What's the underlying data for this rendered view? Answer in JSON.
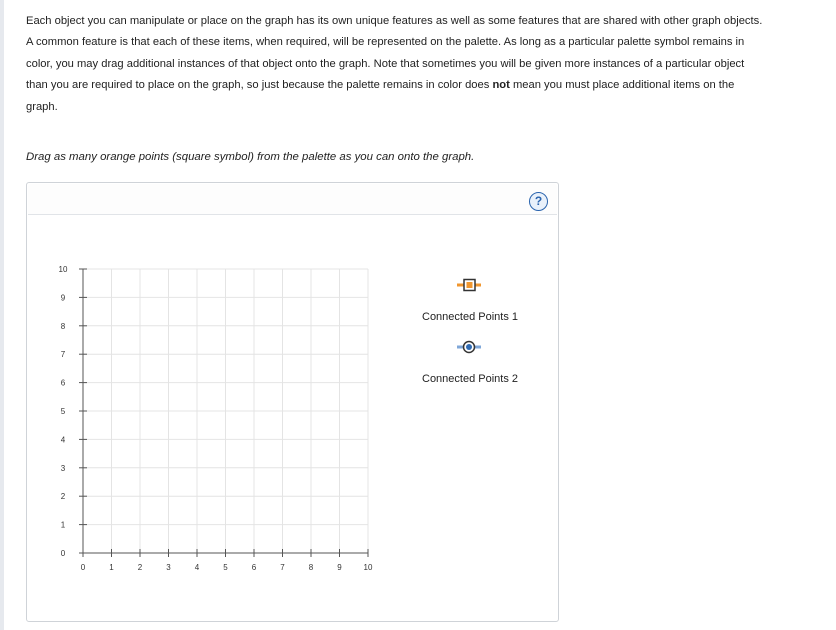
{
  "intro": {
    "line1": "Each object you can manipulate or place on the graph has its own unique features as well as some features that are shared with other graph objects.",
    "line2": "A common feature is that each of these items, when required, will be represented on the palette. As long as a particular palette symbol remains in",
    "line3": "color, you may drag additional instances of that object onto the graph. Note that sometimes you will be given more instances of a particular object",
    "line4_before": "than you are required to place on the graph, so just because the palette remains in color does ",
    "line4_bold": "not",
    "line4_after": " mean you must place additional items on the",
    "line5": "graph."
  },
  "instruction": "Drag as many orange points (square symbol) from the palette as you can onto the graph.",
  "help": {
    "label": "?",
    "icon": "question-circle-icon",
    "color": "#2a64ae"
  },
  "graph": {
    "x_ticks": [
      "0",
      "1",
      "2",
      "3",
      "4",
      "5",
      "6",
      "7",
      "8",
      "9",
      "10"
    ],
    "y_ticks": [
      "0",
      "1",
      "2",
      "3",
      "4",
      "5",
      "6",
      "7",
      "8",
      "9",
      "10"
    ],
    "x_range": [
      0,
      10
    ],
    "y_range": [
      0,
      10
    ],
    "grid": true
  },
  "palette": [
    {
      "label": "Connected Points 1",
      "symbol": "square",
      "color": "#f0962e"
    },
    {
      "label": "Connected Points 2",
      "symbol": "circle",
      "color": "#2f6bb3"
    }
  ]
}
